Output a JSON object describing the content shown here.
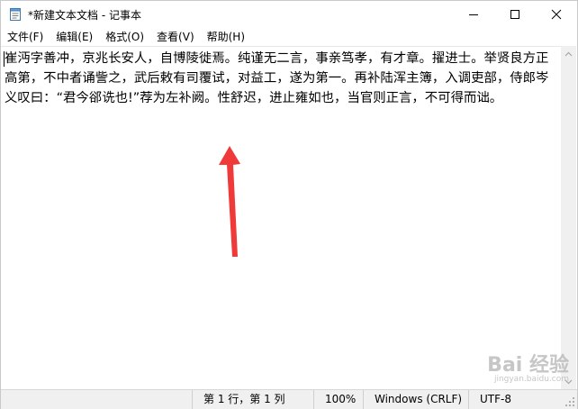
{
  "window": {
    "title": "*新建文本文档 - 记事本"
  },
  "menu": [
    {
      "label": "文件(F)"
    },
    {
      "label": "编辑(E)"
    },
    {
      "label": "格式(O)"
    },
    {
      "label": "查看(V)"
    },
    {
      "label": "帮助(H)"
    }
  ],
  "editor": {
    "content": "崔沔字善冲，京兆长安人，自博陵徙焉。纯谨无二言，事亲笃孝，有才章。擢进士。举贤良方正高第，不中者诵訾之，武后敕有司覆试，对益工，遂为第一。再补陆浑主簿，入调吏部，侍郎岑义叹曰：“君今郤诜也!”荐为左补阙。性舒迟，进止雍如也，当官则正言，不可得而诎。"
  },
  "status": {
    "position": "第 1 行，第 1 列",
    "zoom": "100%",
    "line_ending": "Windows (CRLF)",
    "encoding": "UTF-8"
  },
  "watermark": {
    "text": "Bai 经验",
    "sub": "jingyan.baidu.com"
  },
  "colors": {
    "arrow": "#f03a3a",
    "status_bg": "#f0f0f0"
  }
}
